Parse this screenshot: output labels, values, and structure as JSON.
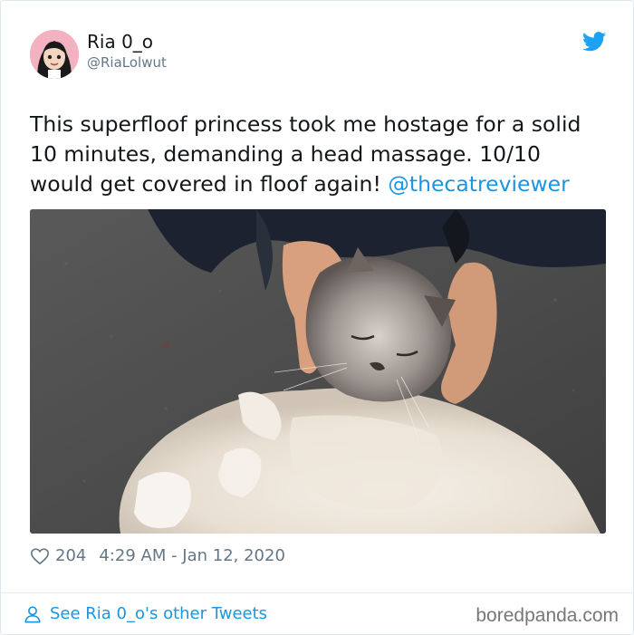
{
  "author": {
    "display_name": "Ria 0_o",
    "handle": "@RiaLolwut"
  },
  "tweet": {
    "text": "This superfloof princess took me hostage for a solid 10 minutes, demanding a head massage. 10/10 would get covered in floof again! ",
    "mention": "@thecatreviewer"
  },
  "stats": {
    "likes": "204",
    "timestamp": "4:29 AM - Jan 12, 2020"
  },
  "footer": {
    "other_tweets_label": "See Ria 0_o's other Tweets"
  },
  "watermark": "boredpanda.com",
  "icons": {
    "brand": "twitter-bird-icon",
    "like": "heart-icon",
    "profile": "person-icon"
  },
  "colors": {
    "link": "#1b95e0",
    "text": "#14171a",
    "muted": "#657786"
  }
}
